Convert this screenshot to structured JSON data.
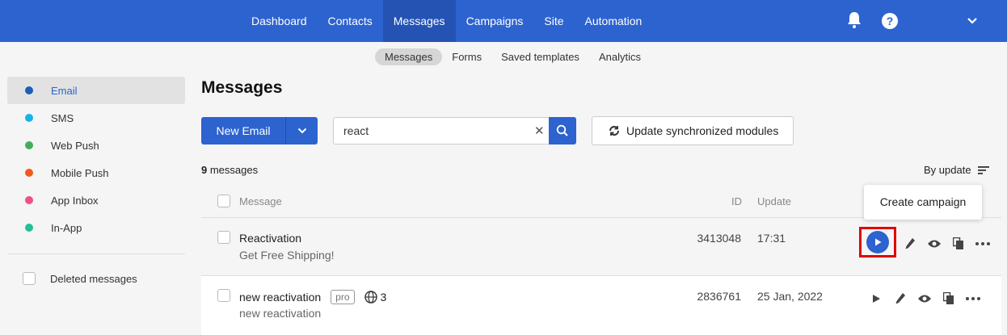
{
  "topnav": {
    "items": [
      "Dashboard",
      "Contacts",
      "Messages",
      "Campaigns",
      "Site",
      "Automation"
    ],
    "active": "Messages",
    "accent": "#2d63cf"
  },
  "subnav": {
    "items": [
      "Messages",
      "Forms",
      "Saved templates",
      "Analytics"
    ],
    "active": "Messages"
  },
  "sidebar": {
    "items": [
      {
        "label": "Email",
        "color": "#1b5fb8"
      },
      {
        "label": "SMS",
        "color": "#16b5e8"
      },
      {
        "label": "Web Push",
        "color": "#45ad5a"
      },
      {
        "label": "Mobile Push",
        "color": "#f05a22"
      },
      {
        "label": "App Inbox",
        "color": "#ee5087"
      },
      {
        "label": "In-App",
        "color": "#22c09a"
      }
    ],
    "deleted_label": "Deleted messages"
  },
  "main": {
    "title": "Messages",
    "new_email_label": "New Email",
    "search_value": "react",
    "update_modules_label": "Update synchronized modules",
    "count_number": "9",
    "count_suffix": " messages",
    "sort_label": "By update",
    "columns": {
      "message": "Message",
      "id": "ID",
      "update": "Update"
    },
    "tooltip": "Create campaign",
    "rows": [
      {
        "title": "Reactivation",
        "subtitle": "Get Free Shipping!",
        "id": "3413048",
        "update": "17:31"
      },
      {
        "title": "new reactivation",
        "badge": "pro",
        "locales": "3",
        "subtitle": "new reactivation",
        "id": "2836761",
        "update": "25 Jan, 2022"
      }
    ]
  },
  "icons": {
    "bell": "bell-icon",
    "help": "help-icon",
    "search": "search-icon",
    "play": "play-icon",
    "edit": "pencil-icon",
    "view": "eye-icon",
    "copy": "copy-icon",
    "more": "more-icon"
  }
}
